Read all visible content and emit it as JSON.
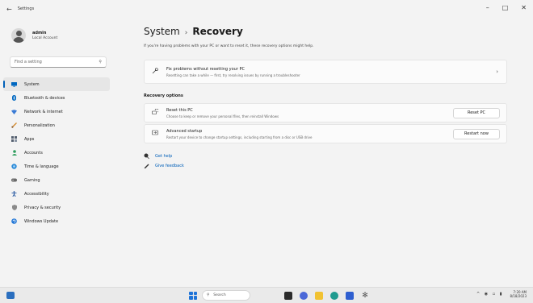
{
  "window": {
    "title": "Settings",
    "controls": [
      "–",
      "□",
      "✕"
    ]
  },
  "profile": {
    "name": "admin",
    "type": "Local Account"
  },
  "search": {
    "placeholder": "Find a setting"
  },
  "nav": [
    {
      "label": "System",
      "icon": "monitor-icon",
      "color": "#0067c0",
      "active": true
    },
    {
      "label": "Bluetooth & devices",
      "icon": "bluetooth-icon",
      "color": "#0067c0"
    },
    {
      "label": "Network & internet",
      "icon": "wifi-icon",
      "color": "#3a7bd5"
    },
    {
      "label": "Personalization",
      "icon": "brush-icon",
      "color": "#d4892a"
    },
    {
      "label": "Apps",
      "icon": "apps-icon",
      "color": "#556070"
    },
    {
      "label": "Accounts",
      "icon": "person-icon",
      "color": "#2e9e5e"
    },
    {
      "label": "Time & language",
      "icon": "globe-clock-icon",
      "color": "#2b8ad8"
    },
    {
      "label": "Gaming",
      "icon": "gamepad-icon",
      "color": "#6a6a6a"
    },
    {
      "label": "Accessibility",
      "icon": "accessibility-icon",
      "color": "#1b4f9c"
    },
    {
      "label": "Privacy & security",
      "icon": "shield-icon",
      "color": "#777"
    },
    {
      "label": "Windows Update",
      "icon": "windows-update-icon",
      "color": "#1d74d6"
    }
  ],
  "page": {
    "section": "System",
    "separator": "›",
    "title": "Recovery",
    "description": "If you're having problems with your PC or want to reset it, these recovery options might help."
  },
  "fix": {
    "title": "Fix problems without resetting your PC",
    "subtitle": "Resetting can take a while — first, try resolving issues by running a troubleshooter"
  },
  "recovery": {
    "heading": "Recovery options",
    "options": [
      {
        "title": "Reset this PC",
        "subtitle": "Choose to keep or remove your personal files, then reinstall Windows",
        "button": "Reset PC",
        "icon": "reset-pc-icon"
      },
      {
        "title": "Advanced startup",
        "subtitle": "Restart your device to change startup settings, including starting from a disc or USB drive",
        "button": "Restart now",
        "icon": "advanced-startup-icon"
      }
    ]
  },
  "links": [
    {
      "label": "Get help",
      "icon": "help-icon"
    },
    {
      "label": "Give feedback",
      "icon": "feedback-icon"
    }
  ],
  "taskbar": {
    "search_label": "Search",
    "time": "7:20 AM",
    "date": "8/18/2023"
  }
}
